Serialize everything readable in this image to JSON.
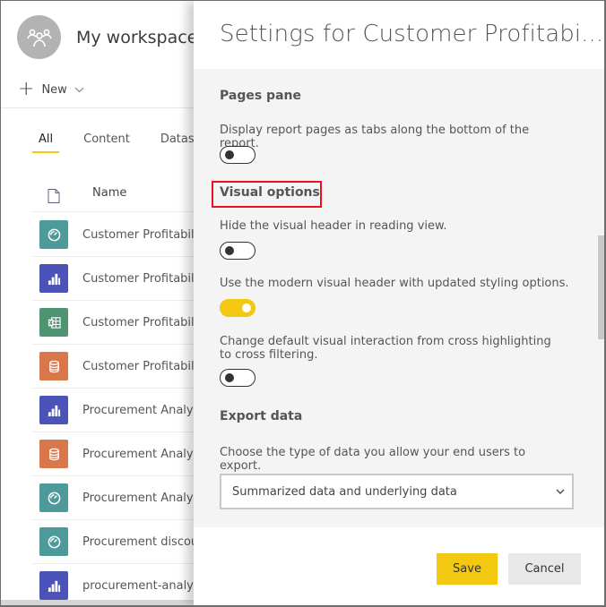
{
  "workspace": {
    "title": "My workspace",
    "avatar_icon": "people-group-icon",
    "new_button_label": "New",
    "tabs": [
      {
        "label": "All",
        "active": true
      },
      {
        "label": "Content",
        "active": false
      },
      {
        "label": "Datasets",
        "active": false
      }
    ],
    "list_header": {
      "type_icon": "file-icon",
      "name_label": "Name"
    },
    "items": [
      {
        "name": "Customer Profitability",
        "type": "dashboard",
        "icon": "gauge-icon",
        "color": "#4c9a9a"
      },
      {
        "name": "Customer Profitability",
        "type": "report",
        "icon": "bar-chart-icon",
        "color": "#4b52b8"
      },
      {
        "name": "Customer Profitability",
        "type": "workbook",
        "icon": "excel-icon",
        "color": "#4f9470"
      },
      {
        "name": "Customer Profitability",
        "type": "dataset",
        "icon": "database-icon",
        "color": "#d9774a"
      },
      {
        "name": "Procurement Analysis",
        "type": "report",
        "icon": "bar-chart-icon",
        "color": "#4b52b8"
      },
      {
        "name": "Procurement Analysis",
        "type": "dataset",
        "icon": "database-icon",
        "color": "#d9774a"
      },
      {
        "name": "Procurement Analysis",
        "type": "dashboard",
        "icon": "gauge-icon",
        "color": "#4c9a9a"
      },
      {
        "name": "Procurement discount",
        "type": "dashboard",
        "icon": "gauge-icon",
        "color": "#4c9a9a"
      },
      {
        "name": "procurement-analysis",
        "type": "report",
        "icon": "bar-chart-icon",
        "color": "#4b52b8"
      }
    ]
  },
  "settings": {
    "title": "Settings for Customer Profitabi...",
    "sections": {
      "pages_pane": {
        "title": "Pages pane",
        "options": [
          {
            "description": "Display report pages as tabs along the bottom of the report.",
            "enabled": false
          }
        ]
      },
      "visual_options": {
        "title": "Visual options",
        "highlighted": true,
        "options": [
          {
            "description": "Hide the visual header in reading view.",
            "enabled": false
          },
          {
            "description": "Use the modern visual header with updated styling options.",
            "enabled": true
          },
          {
            "description": "Change default visual interaction from cross highlighting to cross filtering.",
            "enabled": false
          }
        ]
      },
      "export_data": {
        "title": "Export data",
        "description": "Choose the type of data you allow your end users to export.",
        "selected": "Summarized data and underlying data"
      }
    },
    "save_label": "Save",
    "cancel_label": "Cancel"
  },
  "colors": {
    "accent_yellow": "#f2c811",
    "highlight_red": "#e81123"
  }
}
